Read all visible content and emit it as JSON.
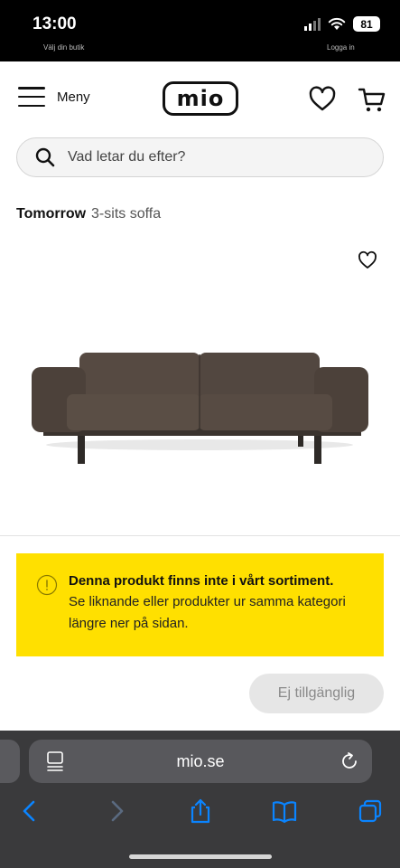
{
  "status_bar": {
    "time": "13:00",
    "battery": "81",
    "peek_left": "Välj din butik",
    "peek_right": "Logga in"
  },
  "header": {
    "menu_label": "Meny",
    "logo_text": "mio"
  },
  "search": {
    "placeholder": "Vad letar du efter?"
  },
  "product": {
    "name": "Tomorrow",
    "subtitle": "3-sits soffa",
    "sofa_color": "#4e433c"
  },
  "notice": {
    "title": "Denna produkt finns inte i vårt sortiment.",
    "text": "Se liknande eller produkter ur samma kategori längre ner på sidan.",
    "background": "#ffe000"
  },
  "actions": {
    "unavailable_label": "Ej tillgänglig"
  },
  "browser": {
    "url": "mio.se",
    "accent": "#0a84ff"
  }
}
